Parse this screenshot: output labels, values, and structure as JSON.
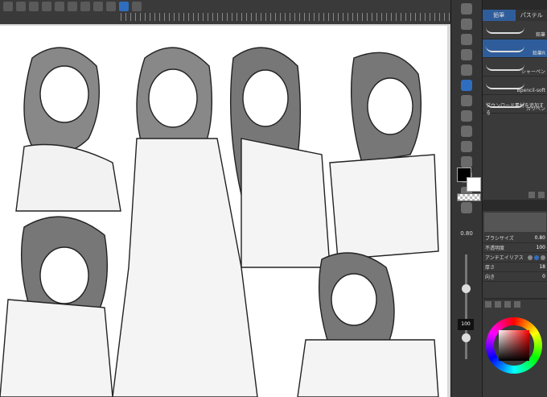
{
  "brush_panel": {
    "tabs": [
      "鉛筆",
      "パステル"
    ],
    "brushes": [
      "鉛筆",
      "鉛筆R",
      "シャーペン",
      "Bpencil-soft",
      "カリペン"
    ],
    "download": "ダウンロード素材を追加する"
  },
  "properties": {
    "rows": [
      {
        "label": "ブラシサイズ",
        "value": "0.80"
      },
      {
        "label": "不透明度",
        "value": "100"
      },
      {
        "label": "アンチエイリアス",
        "value": ""
      },
      {
        "label": "厚さ",
        "value": "18"
      },
      {
        "label": "向き",
        "value": "0"
      }
    ]
  },
  "brush_size": {
    "label": "0.80"
  },
  "opacity": {
    "value": "100"
  },
  "colors": {
    "main": "#000000",
    "sub": "#ffffff"
  }
}
